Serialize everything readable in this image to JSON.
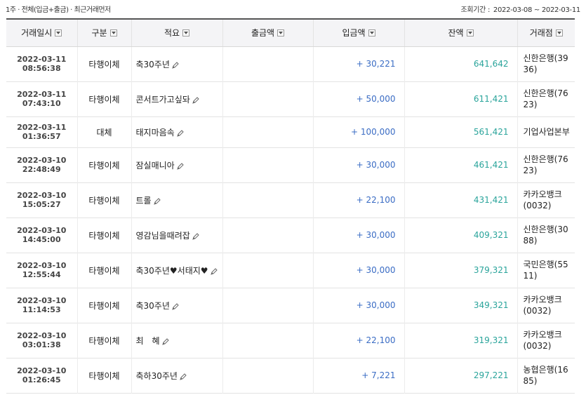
{
  "header": {
    "filter_summary": "1주 · 전체(입금+출금) · 최근거래먼저",
    "period_label": "조회기간 :",
    "period_value": "2022-03-08 ~ 2022-03-11"
  },
  "table": {
    "columns": [
      "거래일시",
      "구분",
      "적요",
      "출금액",
      "입금액",
      "잔액",
      "거래점"
    ],
    "rows": [
      {
        "date": "2022-03-11",
        "time": "08:56:38",
        "type": "타행이체",
        "memo": "축30주년",
        "withdrawal": "",
        "deposit": "+ 30,221",
        "balance": "641,642",
        "branch": "신한은행(3936)"
      },
      {
        "date": "2022-03-11",
        "time": "07:43:10",
        "type": "타행이체",
        "memo": "콘서트가고싶돠",
        "withdrawal": "",
        "deposit": "+ 50,000",
        "balance": "611,421",
        "branch": "신한은행(7623)"
      },
      {
        "date": "2022-03-11",
        "time": "01:36:57",
        "type": "대체",
        "memo": "태지마음속",
        "withdrawal": "",
        "deposit": "+ 100,000",
        "balance": "561,421",
        "branch": "기업사업본부"
      },
      {
        "date": "2022-03-10",
        "time": "22:48:49",
        "type": "타행이체",
        "memo": "잠실매니아",
        "withdrawal": "",
        "deposit": "+ 30,000",
        "balance": "461,421",
        "branch": "신한은행(7623)"
      },
      {
        "date": "2022-03-10",
        "time": "15:05:27",
        "type": "타행이체",
        "memo": "트롤",
        "withdrawal": "",
        "deposit": "+ 22,100",
        "balance": "431,421",
        "branch": "카카오뱅크(0032)"
      },
      {
        "date": "2022-03-10",
        "time": "14:45:00",
        "type": "타행이체",
        "memo": "영감님을때려잡",
        "withdrawal": "",
        "deposit": "+ 30,000",
        "balance": "409,321",
        "branch": "신한은행(3088)"
      },
      {
        "date": "2022-03-10",
        "time": "12:55:44",
        "type": "타행이체",
        "memo": "축30주년♥서태지♥",
        "withdrawal": "",
        "deposit": "+ 30,000",
        "balance": "379,321",
        "branch": "국민은행(5511)"
      },
      {
        "date": "2022-03-10",
        "time": "11:14:53",
        "type": "타행이체",
        "memo": "축30주년",
        "withdrawal": "",
        "deposit": "+ 30,000",
        "balance": "349,321",
        "branch": "카카오뱅크(0032)"
      },
      {
        "date": "2022-03-10",
        "time": "03:01:38",
        "type": "타행이체",
        "memo": "최　혜",
        "withdrawal": "",
        "deposit": "+ 22,100",
        "balance": "319,321",
        "branch": "카카오뱅크(0032)"
      },
      {
        "date": "2022-03-10",
        "time": "01:26:45",
        "type": "타행이체",
        "memo": "축하30주년",
        "withdrawal": "",
        "deposit": "+ 7,221",
        "balance": "297,221",
        "branch": "농협은행(1685)"
      }
    ]
  }
}
